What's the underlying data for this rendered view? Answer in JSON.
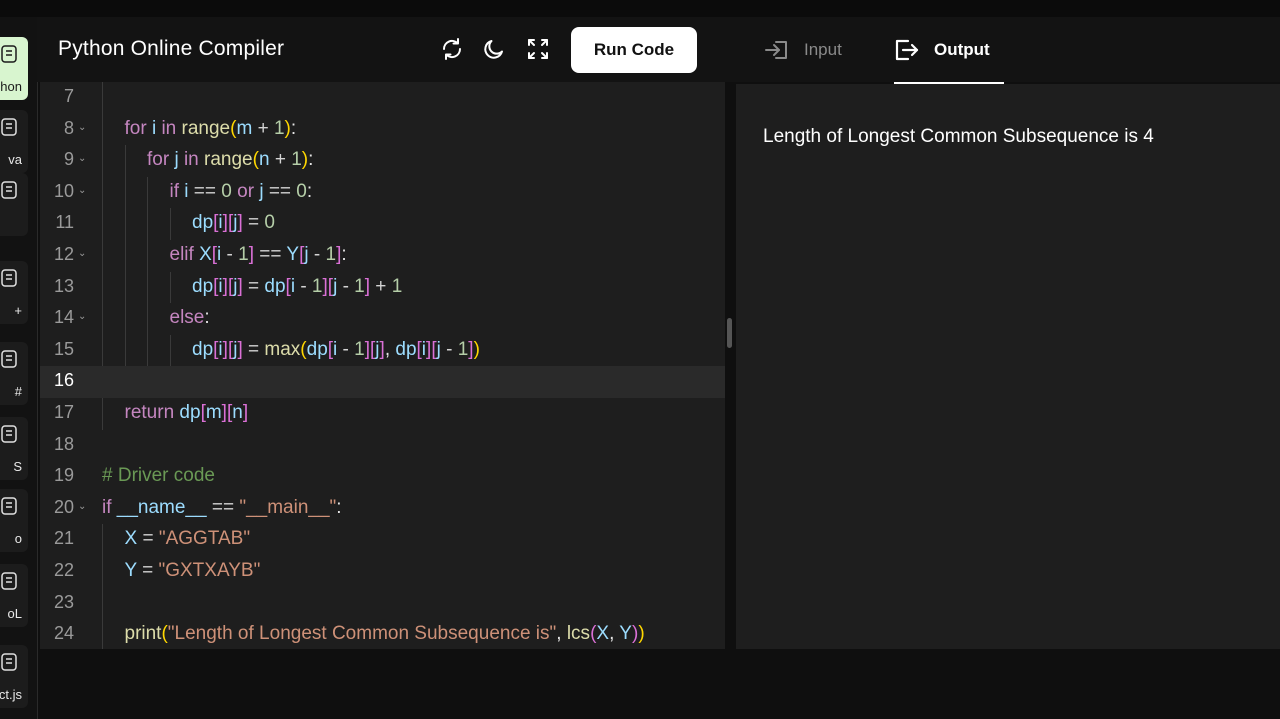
{
  "header": {
    "title": "Python Online Compiler",
    "run_label": "Run Code",
    "tabs": [
      {
        "label": "Input",
        "active": false
      },
      {
        "label": "Output",
        "active": true
      }
    ]
  },
  "sidebar": {
    "items": [
      {
        "label": "hon",
        "icon": "python-icon",
        "active": true
      },
      {
        "label": "va",
        "icon": "java-icon",
        "active": false
      },
      {
        "label": "",
        "icon": "c-icon",
        "active": false
      },
      {
        "label": "+",
        "icon": "cpp-icon",
        "active": false
      },
      {
        "label": "#",
        "icon": "csharp-icon",
        "active": false
      },
      {
        "label": "S",
        "icon": "js-icon",
        "active": false
      },
      {
        "label": "o",
        "icon": "go-icon",
        "active": false
      },
      {
        "label": "oL",
        "icon": "sql-icon",
        "active": false
      },
      {
        "label": "ct.js",
        "icon": "react-icon",
        "active": false
      }
    ]
  },
  "editor": {
    "current_line": 16,
    "lines": [
      {
        "n": "7",
        "fold": false,
        "indent": 1,
        "tokens": []
      },
      {
        "n": "8",
        "fold": true,
        "indent": 1,
        "tokens": [
          [
            "kw",
            "for "
          ],
          [
            "var",
            "i "
          ],
          [
            "kw",
            "in "
          ],
          [
            "fn",
            "range"
          ],
          [
            "br1",
            "("
          ],
          [
            "var",
            "m "
          ],
          [
            "op",
            "+ "
          ],
          [
            "num",
            "1"
          ],
          [
            "br1",
            ")"
          ],
          [
            "plain",
            ":"
          ]
        ]
      },
      {
        "n": "9",
        "fold": true,
        "indent": 2,
        "tokens": [
          [
            "kw",
            "for "
          ],
          [
            "var",
            "j "
          ],
          [
            "kw",
            "in "
          ],
          [
            "fn",
            "range"
          ],
          [
            "br1",
            "("
          ],
          [
            "var",
            "n "
          ],
          [
            "op",
            "+ "
          ],
          [
            "num",
            "1"
          ],
          [
            "br1",
            ")"
          ],
          [
            "plain",
            ":"
          ]
        ]
      },
      {
        "n": "10",
        "fold": true,
        "indent": 3,
        "tokens": [
          [
            "kw",
            "if "
          ],
          [
            "var",
            "i "
          ],
          [
            "op",
            "== "
          ],
          [
            "num",
            "0 "
          ],
          [
            "kw",
            "or "
          ],
          [
            "var",
            "j "
          ],
          [
            "op",
            "== "
          ],
          [
            "num",
            "0"
          ],
          [
            "plain",
            ":"
          ]
        ]
      },
      {
        "n": "11",
        "fold": false,
        "indent": 4,
        "tokens": [
          [
            "var",
            "dp"
          ],
          [
            "br2",
            "["
          ],
          [
            "var",
            "i"
          ],
          [
            "br2",
            "]"
          ],
          [
            "br2",
            "["
          ],
          [
            "var",
            "j"
          ],
          [
            "br2",
            "]"
          ],
          [
            "op",
            " = "
          ],
          [
            "num",
            "0"
          ]
        ]
      },
      {
        "n": "12",
        "fold": true,
        "indent": 3,
        "tokens": [
          [
            "kw",
            "elif "
          ],
          [
            "var",
            "X"
          ],
          [
            "br2",
            "["
          ],
          [
            "var",
            "i "
          ],
          [
            "op",
            "- "
          ],
          [
            "num",
            "1"
          ],
          [
            "br2",
            "]"
          ],
          [
            "op",
            " == "
          ],
          [
            "var",
            "Y"
          ],
          [
            "br2",
            "["
          ],
          [
            "var",
            "j "
          ],
          [
            "op",
            "- "
          ],
          [
            "num",
            "1"
          ],
          [
            "br2",
            "]"
          ],
          [
            "plain",
            ":"
          ]
        ]
      },
      {
        "n": "13",
        "fold": false,
        "indent": 4,
        "tokens": [
          [
            "var",
            "dp"
          ],
          [
            "br2",
            "["
          ],
          [
            "var",
            "i"
          ],
          [
            "br2",
            "]"
          ],
          [
            "br2",
            "["
          ],
          [
            "var",
            "j"
          ],
          [
            "br2",
            "]"
          ],
          [
            "op",
            " = "
          ],
          [
            "var",
            "dp"
          ],
          [
            "br2",
            "["
          ],
          [
            "var",
            "i "
          ],
          [
            "op",
            "- "
          ],
          [
            "num",
            "1"
          ],
          [
            "br2",
            "]"
          ],
          [
            "br2",
            "["
          ],
          [
            "var",
            "j "
          ],
          [
            "op",
            "- "
          ],
          [
            "num",
            "1"
          ],
          [
            "br2",
            "]"
          ],
          [
            "op",
            " + "
          ],
          [
            "num",
            "1"
          ]
        ]
      },
      {
        "n": "14",
        "fold": true,
        "indent": 3,
        "tokens": [
          [
            "kw",
            "else"
          ],
          [
            "plain",
            ":"
          ]
        ]
      },
      {
        "n": "15",
        "fold": false,
        "indent": 4,
        "tokens": [
          [
            "var",
            "dp"
          ],
          [
            "br2",
            "["
          ],
          [
            "var",
            "i"
          ],
          [
            "br2",
            "]"
          ],
          [
            "br2",
            "["
          ],
          [
            "var",
            "j"
          ],
          [
            "br2",
            "]"
          ],
          [
            "op",
            " = "
          ],
          [
            "fn",
            "max"
          ],
          [
            "br1",
            "("
          ],
          [
            "var",
            "dp"
          ],
          [
            "br2",
            "["
          ],
          [
            "var",
            "i "
          ],
          [
            "op",
            "- "
          ],
          [
            "num",
            "1"
          ],
          [
            "br2",
            "]"
          ],
          [
            "br2",
            "["
          ],
          [
            "var",
            "j"
          ],
          [
            "br2",
            "]"
          ],
          [
            "plain",
            ", "
          ],
          [
            "var",
            "dp"
          ],
          [
            "br2",
            "["
          ],
          [
            "var",
            "i"
          ],
          [
            "br2",
            "]"
          ],
          [
            "br2",
            "["
          ],
          [
            "var",
            "j "
          ],
          [
            "op",
            "- "
          ],
          [
            "num",
            "1"
          ],
          [
            "br2",
            "]"
          ],
          [
            "br1",
            ")"
          ]
        ]
      },
      {
        "n": "16",
        "fold": false,
        "indent": 0,
        "tokens": []
      },
      {
        "n": "17",
        "fold": false,
        "indent": 1,
        "tokens": [
          [
            "kw",
            "return "
          ],
          [
            "var",
            "dp"
          ],
          [
            "br2",
            "["
          ],
          [
            "var",
            "m"
          ],
          [
            "br2",
            "]"
          ],
          [
            "br2",
            "["
          ],
          [
            "var",
            "n"
          ],
          [
            "br2",
            "]"
          ]
        ]
      },
      {
        "n": "18",
        "fold": false,
        "indent": 0,
        "tokens": []
      },
      {
        "n": "19",
        "fold": false,
        "indent": 0,
        "tokens": [
          [
            "cm",
            "# Driver code"
          ]
        ]
      },
      {
        "n": "20",
        "fold": true,
        "indent": 0,
        "tokens": [
          [
            "kw",
            "if "
          ],
          [
            "var",
            "__name__ "
          ],
          [
            "op",
            "== "
          ],
          [
            "str",
            "\"__main__\""
          ],
          [
            "plain",
            ":"
          ]
        ]
      },
      {
        "n": "21",
        "fold": false,
        "indent": 1,
        "tokens": [
          [
            "var",
            "X "
          ],
          [
            "op",
            "= "
          ],
          [
            "str",
            "\"AGGTAB\""
          ]
        ]
      },
      {
        "n": "22",
        "fold": false,
        "indent": 1,
        "tokens": [
          [
            "var",
            "Y "
          ],
          [
            "op",
            "= "
          ],
          [
            "str",
            "\"GXTXAYB\""
          ]
        ]
      },
      {
        "n": "23",
        "fold": false,
        "indent": 1,
        "tokens": []
      },
      {
        "n": "24",
        "fold": false,
        "indent": 1,
        "tokens": [
          [
            "fn",
            "print"
          ],
          [
            "br1",
            "("
          ],
          [
            "str",
            "\"Length of Longest Common Subsequence is\""
          ],
          [
            "plain",
            ", "
          ],
          [
            "fn",
            "lcs"
          ],
          [
            "br2",
            "("
          ],
          [
            "var",
            "X"
          ],
          [
            "plain",
            ", "
          ],
          [
            "var",
            "Y"
          ],
          [
            "br2",
            ")"
          ],
          [
            "br1",
            ")"
          ]
        ]
      }
    ]
  },
  "output": {
    "text": "Length of Longest Common Subsequence is 4"
  }
}
